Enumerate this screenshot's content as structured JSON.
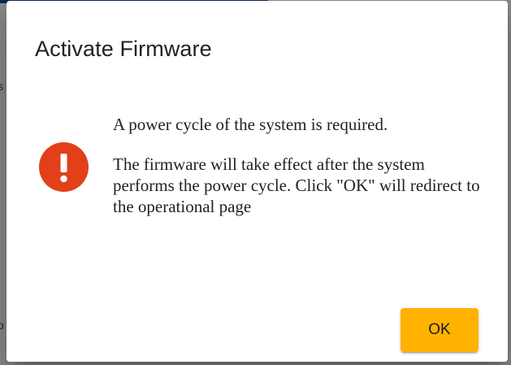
{
  "backdrop": {
    "edge_text_1": "s",
    "edge_text_2": "o"
  },
  "dialog": {
    "title": "Activate Firmware",
    "icon": "alert-circle-icon",
    "message_line_1": "A power cycle of the system is required.",
    "message_line_2": "The firmware will take effect after the system performs the power cycle. Click \"OK\" will redirect to the operational page",
    "ok_label": "OK"
  },
  "colors": {
    "icon": "#e1401a",
    "button": "#ffb300",
    "backdrop": "#8c8c8c"
  }
}
